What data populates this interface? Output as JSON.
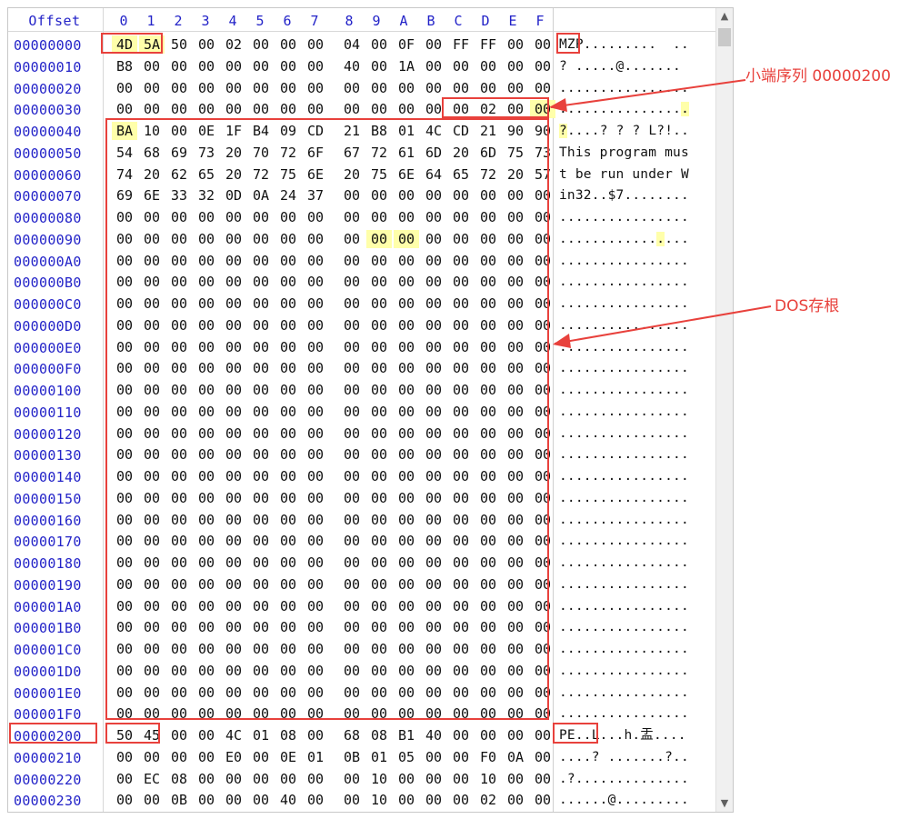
{
  "header": {
    "offset_label": "Offset",
    "columns": [
      "0",
      "1",
      "2",
      "3",
      "4",
      "5",
      "6",
      "7",
      "8",
      "9",
      "A",
      "B",
      "C",
      "D",
      "E",
      "F"
    ]
  },
  "rows": [
    {
      "offset": "00000000",
      "bytes": [
        "4D",
        "5A",
        "50",
        "00",
        "02",
        "00",
        "00",
        "00",
        "04",
        "00",
        "0F",
        "00",
        "FF",
        "FF",
        "00",
        "00"
      ],
      "ascii": "MZP.........  .."
    },
    {
      "offset": "00000010",
      "bytes": [
        "B8",
        "00",
        "00",
        "00",
        "00",
        "00",
        "00",
        "00",
        "40",
        "00",
        "1A",
        "00",
        "00",
        "00",
        "00",
        "00"
      ],
      "ascii": "? .....@......."
    },
    {
      "offset": "00000020",
      "bytes": [
        "00",
        "00",
        "00",
        "00",
        "00",
        "00",
        "00",
        "00",
        "00",
        "00",
        "00",
        "00",
        "00",
        "00",
        "00",
        "00"
      ],
      "ascii": "................"
    },
    {
      "offset": "00000030",
      "bytes": [
        "00",
        "00",
        "00",
        "00",
        "00",
        "00",
        "00",
        "00",
        "00",
        "00",
        "00",
        "00",
        "00",
        "02",
        "00",
        "00"
      ],
      "ascii": "................"
    },
    {
      "offset": "00000040",
      "bytes": [
        "BA",
        "10",
        "00",
        "0E",
        "1F",
        "B4",
        "09",
        "CD",
        "21",
        "B8",
        "01",
        "4C",
        "CD",
        "21",
        "90",
        "90"
      ],
      "ascii": "?....? ? ? L?!.."
    },
    {
      "offset": "00000050",
      "bytes": [
        "54",
        "68",
        "69",
        "73",
        "20",
        "70",
        "72",
        "6F",
        "67",
        "72",
        "61",
        "6D",
        "20",
        "6D",
        "75",
        "73"
      ],
      "ascii": "This program mus"
    },
    {
      "offset": "00000060",
      "bytes": [
        "74",
        "20",
        "62",
        "65",
        "20",
        "72",
        "75",
        "6E",
        "20",
        "75",
        "6E",
        "64",
        "65",
        "72",
        "20",
        "57"
      ],
      "ascii": "t be run under W"
    },
    {
      "offset": "00000070",
      "bytes": [
        "69",
        "6E",
        "33",
        "32",
        "0D",
        "0A",
        "24",
        "37",
        "00",
        "00",
        "00",
        "00",
        "00",
        "00",
        "00",
        "00"
      ],
      "ascii": "in32..$7........"
    },
    {
      "offset": "00000080",
      "bytes": [
        "00",
        "00",
        "00",
        "00",
        "00",
        "00",
        "00",
        "00",
        "00",
        "00",
        "00",
        "00",
        "00",
        "00",
        "00",
        "00"
      ],
      "ascii": "................"
    },
    {
      "offset": "00000090",
      "bytes": [
        "00",
        "00",
        "00",
        "00",
        "00",
        "00",
        "00",
        "00",
        "00",
        "00",
        "00",
        "00",
        "00",
        "00",
        "00",
        "00"
      ],
      "ascii": "................"
    },
    {
      "offset": "000000A0",
      "bytes": [
        "00",
        "00",
        "00",
        "00",
        "00",
        "00",
        "00",
        "00",
        "00",
        "00",
        "00",
        "00",
        "00",
        "00",
        "00",
        "00"
      ],
      "ascii": "................"
    },
    {
      "offset": "000000B0",
      "bytes": [
        "00",
        "00",
        "00",
        "00",
        "00",
        "00",
        "00",
        "00",
        "00",
        "00",
        "00",
        "00",
        "00",
        "00",
        "00",
        "00"
      ],
      "ascii": "................"
    },
    {
      "offset": "000000C0",
      "bytes": [
        "00",
        "00",
        "00",
        "00",
        "00",
        "00",
        "00",
        "00",
        "00",
        "00",
        "00",
        "00",
        "00",
        "00",
        "00",
        "00"
      ],
      "ascii": "................"
    },
    {
      "offset": "000000D0",
      "bytes": [
        "00",
        "00",
        "00",
        "00",
        "00",
        "00",
        "00",
        "00",
        "00",
        "00",
        "00",
        "00",
        "00",
        "00",
        "00",
        "00"
      ],
      "ascii": "................"
    },
    {
      "offset": "000000E0",
      "bytes": [
        "00",
        "00",
        "00",
        "00",
        "00",
        "00",
        "00",
        "00",
        "00",
        "00",
        "00",
        "00",
        "00",
        "00",
        "00",
        "00"
      ],
      "ascii": "................"
    },
    {
      "offset": "000000F0",
      "bytes": [
        "00",
        "00",
        "00",
        "00",
        "00",
        "00",
        "00",
        "00",
        "00",
        "00",
        "00",
        "00",
        "00",
        "00",
        "00",
        "00"
      ],
      "ascii": "................"
    },
    {
      "offset": "00000100",
      "bytes": [
        "00",
        "00",
        "00",
        "00",
        "00",
        "00",
        "00",
        "00",
        "00",
        "00",
        "00",
        "00",
        "00",
        "00",
        "00",
        "00"
      ],
      "ascii": "................"
    },
    {
      "offset": "00000110",
      "bytes": [
        "00",
        "00",
        "00",
        "00",
        "00",
        "00",
        "00",
        "00",
        "00",
        "00",
        "00",
        "00",
        "00",
        "00",
        "00",
        "00"
      ],
      "ascii": "................"
    },
    {
      "offset": "00000120",
      "bytes": [
        "00",
        "00",
        "00",
        "00",
        "00",
        "00",
        "00",
        "00",
        "00",
        "00",
        "00",
        "00",
        "00",
        "00",
        "00",
        "00"
      ],
      "ascii": "................"
    },
    {
      "offset": "00000130",
      "bytes": [
        "00",
        "00",
        "00",
        "00",
        "00",
        "00",
        "00",
        "00",
        "00",
        "00",
        "00",
        "00",
        "00",
        "00",
        "00",
        "00"
      ],
      "ascii": "................"
    },
    {
      "offset": "00000140",
      "bytes": [
        "00",
        "00",
        "00",
        "00",
        "00",
        "00",
        "00",
        "00",
        "00",
        "00",
        "00",
        "00",
        "00",
        "00",
        "00",
        "00"
      ],
      "ascii": "................"
    },
    {
      "offset": "00000150",
      "bytes": [
        "00",
        "00",
        "00",
        "00",
        "00",
        "00",
        "00",
        "00",
        "00",
        "00",
        "00",
        "00",
        "00",
        "00",
        "00",
        "00"
      ],
      "ascii": "................"
    },
    {
      "offset": "00000160",
      "bytes": [
        "00",
        "00",
        "00",
        "00",
        "00",
        "00",
        "00",
        "00",
        "00",
        "00",
        "00",
        "00",
        "00",
        "00",
        "00",
        "00"
      ],
      "ascii": "................"
    },
    {
      "offset": "00000170",
      "bytes": [
        "00",
        "00",
        "00",
        "00",
        "00",
        "00",
        "00",
        "00",
        "00",
        "00",
        "00",
        "00",
        "00",
        "00",
        "00",
        "00"
      ],
      "ascii": "................"
    },
    {
      "offset": "00000180",
      "bytes": [
        "00",
        "00",
        "00",
        "00",
        "00",
        "00",
        "00",
        "00",
        "00",
        "00",
        "00",
        "00",
        "00",
        "00",
        "00",
        "00"
      ],
      "ascii": "................"
    },
    {
      "offset": "00000190",
      "bytes": [
        "00",
        "00",
        "00",
        "00",
        "00",
        "00",
        "00",
        "00",
        "00",
        "00",
        "00",
        "00",
        "00",
        "00",
        "00",
        "00"
      ],
      "ascii": "................"
    },
    {
      "offset": "000001A0",
      "bytes": [
        "00",
        "00",
        "00",
        "00",
        "00",
        "00",
        "00",
        "00",
        "00",
        "00",
        "00",
        "00",
        "00",
        "00",
        "00",
        "00"
      ],
      "ascii": "................"
    },
    {
      "offset": "000001B0",
      "bytes": [
        "00",
        "00",
        "00",
        "00",
        "00",
        "00",
        "00",
        "00",
        "00",
        "00",
        "00",
        "00",
        "00",
        "00",
        "00",
        "00"
      ],
      "ascii": "................"
    },
    {
      "offset": "000001C0",
      "bytes": [
        "00",
        "00",
        "00",
        "00",
        "00",
        "00",
        "00",
        "00",
        "00",
        "00",
        "00",
        "00",
        "00",
        "00",
        "00",
        "00"
      ],
      "ascii": "................"
    },
    {
      "offset": "000001D0",
      "bytes": [
        "00",
        "00",
        "00",
        "00",
        "00",
        "00",
        "00",
        "00",
        "00",
        "00",
        "00",
        "00",
        "00",
        "00",
        "00",
        "00"
      ],
      "ascii": "................"
    },
    {
      "offset": "000001E0",
      "bytes": [
        "00",
        "00",
        "00",
        "00",
        "00",
        "00",
        "00",
        "00",
        "00",
        "00",
        "00",
        "00",
        "00",
        "00",
        "00",
        "00"
      ],
      "ascii": "................"
    },
    {
      "offset": "000001F0",
      "bytes": [
        "00",
        "00",
        "00",
        "00",
        "00",
        "00",
        "00",
        "00",
        "00",
        "00",
        "00",
        "00",
        "00",
        "00",
        "00",
        "00"
      ],
      "ascii": "................"
    },
    {
      "offset": "00000200",
      "bytes": [
        "50",
        "45",
        "00",
        "00",
        "4C",
        "01",
        "08",
        "00",
        "68",
        "08",
        "B1",
        "40",
        "00",
        "00",
        "00",
        "00"
      ],
      "ascii": "PE..L...h.盂...."
    },
    {
      "offset": "00000210",
      "bytes": [
        "00",
        "00",
        "00",
        "00",
        "E0",
        "00",
        "0E",
        "01",
        "0B",
        "01",
        "05",
        "00",
        "00",
        "F0",
        "0A",
        "00"
      ],
      "ascii": "....? .......?.."
    },
    {
      "offset": "00000220",
      "bytes": [
        "00",
        "EC",
        "08",
        "00",
        "00",
        "00",
        "00",
        "00",
        "00",
        "10",
        "00",
        "00",
        "00",
        "10",
        "00",
        "00"
      ],
      "ascii": ".?.............."
    },
    {
      "offset": "00000230",
      "bytes": [
        "00",
        "00",
        "0B",
        "00",
        "00",
        "00",
        "40",
        "00",
        "00",
        "10",
        "00",
        "00",
        "00",
        "02",
        "00",
        "00"
      ],
      "ascii": "......@........."
    }
  ],
  "highlight_bytes": [
    [
      0,
      0
    ],
    [
      0,
      1
    ],
    [
      3,
      15
    ],
    [
      4,
      0
    ],
    [
      9,
      9
    ],
    [
      9,
      10
    ]
  ],
  "highlight_ascii": [
    [
      3,
      15
    ],
    [
      4,
      0
    ],
    [
      9,
      12
    ]
  ],
  "annotations": {
    "little_endian": "小端序列 00000200",
    "dos_stub": "DOS存根"
  },
  "colors": {
    "offset_text": "#2323c8",
    "highlight": "#ffffaa",
    "annotation": "#e8413c"
  }
}
